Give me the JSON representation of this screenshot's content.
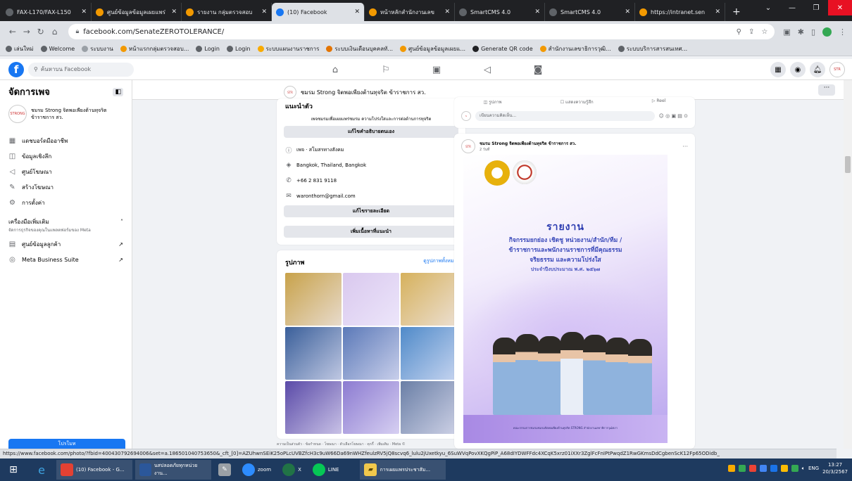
{
  "browser": {
    "tabs": [
      {
        "title": "FAX-L170/FAX-L150",
        "color": "#5f6368",
        "active": false
      },
      {
        "title": "ศูนย์ข้อมูลข้อมูลเผยแพร่",
        "color": "#f29900",
        "active": false
      },
      {
        "title": "รายงาน กลุ่มตรวจสอบ",
        "color": "#f29900",
        "active": false
      },
      {
        "title": "(10) Facebook",
        "color": "#1877f2",
        "active": true
      },
      {
        "title": "หน้าหลักสำนักงานเลข",
        "color": "#f29900",
        "active": false
      },
      {
        "title": "SmartCMS 4.0",
        "color": "#5f6368",
        "active": false
      },
      {
        "title": "SmartCMS 4.0",
        "color": "#5f6368",
        "active": false
      },
      {
        "title": "https://intranet.sen",
        "color": "#f29900",
        "active": false
      }
    ],
    "url": "facebook.com/SenateZEROTOLERANCE/",
    "bookmarks": [
      {
        "label": "เล่นใหม่",
        "color": "#5f6368"
      },
      {
        "label": "Welcome",
        "color": "#5f6368"
      },
      {
        "label": "ระบบงาน",
        "color": "#9aa0a6"
      },
      {
        "label": "หน้าแรกกลุ่มตรวจสอบ...",
        "color": "#f29900"
      },
      {
        "label": "Login",
        "color": "#5f6368"
      },
      {
        "label": "Login",
        "color": "#5f6368"
      },
      {
        "label": "ระบบแผนงานราชการ",
        "color": "#f9ab00"
      },
      {
        "label": "ระบบเงินเดือนบุคคลทั...",
        "color": "#e37400"
      },
      {
        "label": "ศูนย์ข้อมูลข้อมูลเผยแ...",
        "color": "#f29900"
      },
      {
        "label": "Generate QR code",
        "color": "#202124"
      },
      {
        "label": "สำนักงานเลขาธิการวุฒิ...",
        "color": "#f29900"
      },
      {
        "label": "ระบบบริการสารสนเทศ...",
        "color": "#5f6368"
      }
    ]
  },
  "fb": {
    "search_placeholder": "ค้นหาบน Facebook",
    "sidebar": {
      "title": "จัดการเพจ",
      "page_name": "ชมรม Strong จิตพอเพียงต้านทุจริต ข้าราชการ สว.",
      "items": [
        {
          "label": "แดชบอร์ดมืออาชีพ",
          "icon": "dashboard-icon",
          "glyph": "▦"
        },
        {
          "label": "ข้อมูลเชิงลึก",
          "icon": "insights-icon",
          "glyph": "◫"
        },
        {
          "label": "ศูนย์โฆษณา",
          "icon": "ads-icon",
          "glyph": "◁"
        },
        {
          "label": "สร้างโฆษณา",
          "icon": "create-ad-icon",
          "glyph": "✎"
        },
        {
          "label": "การตั้งค่า",
          "icon": "settings-icon",
          "glyph": "⚙"
        }
      ],
      "tools_title": "เครื่องมือเพิ่มเติม",
      "tools_sub": "จัดการธุรกิจของคุณในแพลตฟอร์มของ Meta",
      "tools": [
        {
          "label": "ศูนย์ข้อมูลลูกค้า",
          "icon": "customer-center-icon",
          "glyph": "▤"
        },
        {
          "label": "Meta Business Suite",
          "icon": "business-suite-icon",
          "glyph": "◎"
        }
      ],
      "bottom_button": "โปรโมท"
    },
    "pagebar_name": "ชมรม Strong จิตพอเพียงต้านทุจริต ข้าราชการ สว.",
    "intro": {
      "title": "แนะนำตัว",
      "text": "เพจชมรมเพื่อเผยแพร่ชมรม ความโปร่งใสและการต่อต้านการทุจริต",
      "edit_bio": "แก้ไขคำอธิบายตนเอง",
      "rows": [
        {
          "icon": "info-icon",
          "glyph": "ⓘ",
          "text": "เพจ · สโมสรทางสังคม"
        },
        {
          "icon": "location-icon",
          "glyph": "◈",
          "text": "Bangkok, Thailand, Bangkok"
        },
        {
          "icon": "phone-icon",
          "glyph": "✆",
          "text": "+66 2 831 9118"
        },
        {
          "icon": "email-icon",
          "glyph": "✉",
          "text": "waronthorn@gmail.com"
        }
      ],
      "edit_details": "แก้ไขรายละเอียด",
      "add_featured": "เพิ่มเนื้อหาที่แนะนำ"
    },
    "photos": {
      "title": "รูปภาพ",
      "see_all": "ดูรูปภาพทั้งหมด",
      "tiles": [
        {
          "name": "photo-awards-1",
          "color": "#c8a24a"
        },
        {
          "name": "photo-poster-1",
          "color": "#d9c8ee"
        },
        {
          "name": "photo-awards-2",
          "color": "#d6b15c"
        },
        {
          "name": "photo-group-1",
          "color": "#3a5f9a"
        },
        {
          "name": "photo-meeting-1",
          "color": "#5b79b8"
        },
        {
          "name": "photo-poster-2",
          "color": "#4f8ac9"
        },
        {
          "name": "photo-survey",
          "color": "#5a4aa8"
        },
        {
          "name": "photo-poster-3",
          "color": "#8c7bd1"
        },
        {
          "name": "photo-collage",
          "color": "#6a7fa6"
        }
      ]
    },
    "footer_links": "ความเป็นส่วนตัว · ข้อกำหนด · โฆษณา · ตัวเลือกโฆษณา · คุกกี้ · เพิ่มเติม · Meta ©",
    "composer": {
      "photo_label": "รูปภาพ",
      "feeling_label": "แสดงความรู้สึก",
      "reel_label": "Reel",
      "comment_placeholder": "เขียนความคิดเห็น..."
    },
    "post": {
      "author": "ชมรม Strong จิตพอเพียงต้านทุจริต ข้าราชการ สว.",
      "time": "2 วันที่",
      "report_heading": "รายงาน",
      "report_line1": "กิจกรรมยกย่อง เชิดชู หน่วยงาน/สำนัก/ทีม /",
      "report_line2": "ข้าราชการและพนักงานราชการที่มีคุณธรรม",
      "report_line3": "จริยธรรม และความโปร่งใส",
      "report_line4": "ประจำปีงบประมาณ พ.ศ. ๒๕๖๗",
      "bottom_caption": "คณะกรรมการชมรมชมรมจิตพอเพียงต้านทุจริต STRONG สำนักงานเลขาธิการวุฒิสภา"
    }
  },
  "status_url": "https://www.facebook.com/photo/?fbid=400430792694006&set=a.186501040753650&_cft_[0]=AZUhwnSEiK25oPLcUVBZfcH3c9uW66Da69nWHZfeulzRV5jQ8scvq6_lulu2jUxetkyu_6SuWVqPovXKQgPiP_A68dIYDWFFdc4XCqK5xrz01iXXr3ZglFcFnIPtPwqdZ1RwGKmsDdCgbenScK12Fp65ODidb_",
  "taskbar": {
    "tasks": [
      {
        "label": "(10) Facebook - G...",
        "color": "#e34133"
      },
      {
        "label": "นสปลอดภัยทุกหน่วยงาน...",
        "color": "#2b579a"
      }
    ],
    "apps": [
      {
        "label": "zoom",
        "color": "#2d8cff"
      },
      {
        "label": "X",
        "color": "#217346"
      },
      {
        "label": "LINE",
        "color": "#06c755"
      }
    ],
    "folder_task": "การเผยแพรประชาสัม...",
    "lang": "ENG",
    "time": "13:27",
    "date": "20/3/2567"
  }
}
